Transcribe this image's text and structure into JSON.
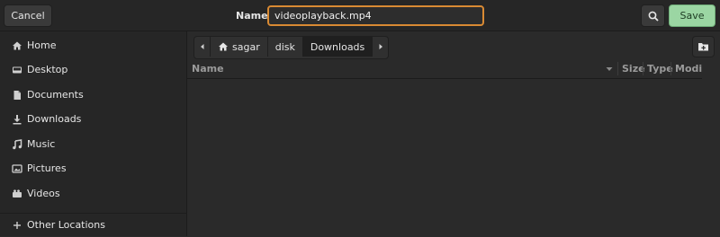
{
  "header": {
    "cancel_label": "Cancel",
    "name_label": "Name",
    "filename_value": "videoplayback.mp4",
    "save_label": "Save"
  },
  "sidebar": {
    "items": [
      {
        "label": "Home",
        "icon": "home-icon"
      },
      {
        "label": "Desktop",
        "icon": "desktop-icon"
      },
      {
        "label": "Documents",
        "icon": "document-icon"
      },
      {
        "label": "Downloads",
        "icon": "download-icon"
      },
      {
        "label": "Music",
        "icon": "music-icon"
      },
      {
        "label": "Pictures",
        "icon": "picture-icon"
      },
      {
        "label": "Videos",
        "icon": "video-icon"
      }
    ],
    "other_locations": "Other Locations"
  },
  "pathbar": {
    "segments": [
      "sagar",
      "disk",
      "Downloads"
    ],
    "active": "Downloads"
  },
  "columns": {
    "name": "Name",
    "size": "Size",
    "type": "Type",
    "modified": "Modified"
  },
  "colors": {
    "accent_focus": "#d98a33",
    "save_bg": "#9bd6a3",
    "background": "#2a2a2a"
  }
}
